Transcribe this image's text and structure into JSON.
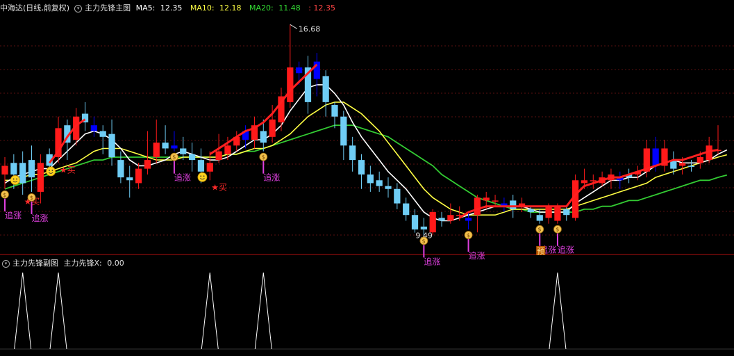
{
  "header_main": {
    "stock_label": "中海达(日线,前复权)",
    "indicator_title": "主力先锋主图",
    "ma5_label": "MA5:",
    "ma5_value": "12.35",
    "ma10_label": "MA10:",
    "ma10_value": "12.18",
    "ma20_label": "MA20:",
    "ma20_value": "11.48",
    "last_value": ": 12.35"
  },
  "header_sub": {
    "indicator_title": "主力先锋副图",
    "value_label": "主力先锋X:",
    "value": "0.00"
  },
  "colors": {
    "up": "#ff1a1a",
    "down": "#6fcdf5",
    "blue_down": "#0000ff",
    "ma5": "#ffffff",
    "ma10": "#ffff44",
    "ma20": "#33cc33",
    "signal": "#ff2020",
    "grid": "#5a1010",
    "buy_text": "#ff2a2a",
    "chase_text": "#e040e0"
  },
  "chart_data": {
    "type": "candlestick",
    "y_max_label": "16.68",
    "y_min_label": "9.49",
    "preview_label": "预",
    "buy_label": "★买",
    "chase_label": "追涨",
    "buy_signals": [
      2,
      6,
      23
    ],
    "smiley_signals": [
      1,
      5,
      22
    ],
    "chase_signals": [
      0,
      3,
      19,
      29,
      47,
      52,
      60,
      62
    ],
    "sub_peaks": [
      2,
      6,
      23,
      29,
      62
    ],
    "candles": [
      {
        "o": 11.5,
        "c": 11.8,
        "h": 12.1,
        "l": 11.0,
        "color": "up"
      },
      {
        "o": 11.9,
        "c": 11.5,
        "h": 12.2,
        "l": 11.0,
        "color": "down"
      },
      {
        "o": 11.9,
        "c": 11.2,
        "h": 12.3,
        "l": 10.8,
        "color": "down"
      },
      {
        "o": 12.0,
        "c": 11.4,
        "h": 12.5,
        "l": 10.9,
        "color": "down"
      },
      {
        "o": 10.9,
        "c": 11.9,
        "h": 12.2,
        "l": 10.5,
        "color": "up"
      },
      {
        "o": 12.2,
        "c": 11.8,
        "h": 12.4,
        "l": 11.6,
        "color": "down"
      },
      {
        "o": 12.1,
        "c": 13.1,
        "h": 13.5,
        "l": 11.9,
        "color": "up"
      },
      {
        "o": 13.2,
        "c": 12.6,
        "h": 13.4,
        "l": 12.0,
        "color": "down"
      },
      {
        "o": 12.7,
        "c": 13.5,
        "h": 13.8,
        "l": 12.5,
        "color": "up"
      },
      {
        "o": 13.6,
        "c": 13.3,
        "h": 14.0,
        "l": 13.0,
        "color": "down"
      },
      {
        "o": 13.2,
        "c": 13.0,
        "h": 13.5,
        "l": 12.8,
        "color": "blue_down"
      },
      {
        "o": 13.0,
        "c": 12.8,
        "h": 13.2,
        "l": 12.2,
        "color": "down"
      },
      {
        "o": 12.9,
        "c": 12.1,
        "h": 13.4,
        "l": 11.8,
        "color": "down"
      },
      {
        "o": 12.0,
        "c": 11.4,
        "h": 12.3,
        "l": 11.2,
        "color": "down"
      },
      {
        "o": 11.4,
        "c": 11.3,
        "h": 11.8,
        "l": 10.7,
        "color": "down"
      },
      {
        "o": 11.2,
        "c": 11.7,
        "h": 11.9,
        "l": 11.0,
        "color": "up"
      },
      {
        "o": 11.7,
        "c": 12.0,
        "h": 13.0,
        "l": 11.5,
        "color": "up"
      },
      {
        "o": 12.1,
        "c": 12.6,
        "h": 13.4,
        "l": 11.9,
        "color": "up"
      },
      {
        "o": 12.6,
        "c": 12.4,
        "h": 13.2,
        "l": 12.2,
        "color": "down"
      },
      {
        "o": 12.4,
        "c": 12.5,
        "h": 13.0,
        "l": 12.3,
        "color": "blue_down"
      },
      {
        "o": 12.4,
        "c": 12.2,
        "h": 12.8,
        "l": 12.0,
        "color": "down"
      },
      {
        "o": 12.2,
        "c": 12.0,
        "h": 12.6,
        "l": 11.6,
        "color": "down"
      },
      {
        "o": 12.0,
        "c": 11.6,
        "h": 12.4,
        "l": 11.2,
        "color": "down"
      },
      {
        "o": 11.6,
        "c": 11.9,
        "h": 12.3,
        "l": 11.3,
        "color": "up"
      },
      {
        "o": 12.0,
        "c": 12.3,
        "h": 12.9,
        "l": 11.9,
        "color": "up"
      },
      {
        "o": 12.2,
        "c": 12.5,
        "h": 12.8,
        "l": 12.0,
        "color": "up"
      },
      {
        "o": 12.5,
        "c": 12.8,
        "h": 13.0,
        "l": 12.3,
        "color": "up"
      },
      {
        "o": 12.7,
        "c": 13.0,
        "h": 13.2,
        "l": 12.4,
        "color": "blue_down"
      },
      {
        "o": 12.7,
        "c": 13.2,
        "h": 13.5,
        "l": 12.4,
        "color": "up"
      },
      {
        "o": 13.0,
        "c": 12.6,
        "h": 13.4,
        "l": 12.3,
        "color": "down"
      },
      {
        "o": 12.8,
        "c": 13.4,
        "h": 13.9,
        "l": 12.6,
        "color": "up"
      },
      {
        "o": 13.3,
        "c": 14.2,
        "h": 14.5,
        "l": 13.0,
        "color": "up"
      },
      {
        "o": 14.0,
        "c": 15.2,
        "h": 16.68,
        "l": 13.8,
        "color": "up"
      },
      {
        "o": 15.2,
        "c": 15.0,
        "h": 15.4,
        "l": 14.6,
        "color": "blue_down"
      },
      {
        "o": 15.2,
        "c": 14.0,
        "h": 15.6,
        "l": 13.6,
        "color": "down"
      },
      {
        "o": 15.4,
        "c": 14.8,
        "h": 15.7,
        "l": 14.2,
        "color": "blue_down"
      },
      {
        "o": 14.9,
        "c": 14.0,
        "h": 15.1,
        "l": 13.5,
        "color": "down"
      },
      {
        "o": 13.9,
        "c": 13.5,
        "h": 14.0,
        "l": 13.1,
        "color": "down"
      },
      {
        "o": 13.5,
        "c": 12.5,
        "h": 13.7,
        "l": 12.0,
        "color": "down"
      },
      {
        "o": 12.5,
        "c": 12.0,
        "h": 12.8,
        "l": 11.6,
        "color": "down"
      },
      {
        "o": 12.0,
        "c": 11.5,
        "h": 12.2,
        "l": 11.0,
        "color": "down"
      },
      {
        "o": 11.5,
        "c": 11.2,
        "h": 11.8,
        "l": 10.9,
        "color": "down"
      },
      {
        "o": 11.3,
        "c": 11.1,
        "h": 11.6,
        "l": 10.9,
        "color": "down"
      },
      {
        "o": 11.1,
        "c": 11.0,
        "h": 11.4,
        "l": 10.7,
        "color": "down"
      },
      {
        "o": 11.0,
        "c": 10.5,
        "h": 11.2,
        "l": 10.3,
        "color": "down"
      },
      {
        "o": 10.5,
        "c": 10.1,
        "h": 10.7,
        "l": 9.9,
        "color": "down"
      },
      {
        "o": 10.1,
        "c": 9.6,
        "h": 10.3,
        "l": 9.49,
        "color": "down"
      },
      {
        "o": 9.6,
        "c": 9.7,
        "h": 10.0,
        "l": 9.4,
        "color": "down"
      },
      {
        "o": 9.5,
        "c": 10.2,
        "h": 10.3,
        "l": 9.4,
        "color": "up"
      },
      {
        "o": 9.9,
        "c": 10.0,
        "h": 10.2,
        "l": 9.7,
        "color": "down"
      },
      {
        "o": 9.9,
        "c": 10.1,
        "h": 10.5,
        "l": 9.8,
        "color": "up"
      },
      {
        "o": 10.1,
        "c": 10.1,
        "h": 10.4,
        "l": 9.9,
        "color": "up"
      },
      {
        "o": 10.0,
        "c": 9.9,
        "h": 10.2,
        "l": 9.6,
        "color": "blue_down"
      },
      {
        "o": 10.1,
        "c": 10.7,
        "h": 10.8,
        "l": 9.5,
        "color": "up"
      },
      {
        "o": 10.6,
        "c": 10.7,
        "h": 10.9,
        "l": 10.3,
        "color": "up"
      },
      {
        "o": 10.6,
        "c": 10.6,
        "h": 10.8,
        "l": 10.4,
        "color": "up"
      },
      {
        "o": 10.5,
        "c": 10.4,
        "h": 10.7,
        "l": 10.2,
        "color": "blue_down"
      },
      {
        "o": 10.6,
        "c": 10.3,
        "h": 10.8,
        "l": 10.0,
        "color": "down"
      },
      {
        "o": 10.4,
        "c": 10.5,
        "h": 10.7,
        "l": 10.2,
        "color": "up"
      },
      {
        "o": 10.3,
        "c": 10.2,
        "h": 10.4,
        "l": 10.0,
        "color": "down"
      },
      {
        "o": 10.1,
        "c": 9.9,
        "h": 10.3,
        "l": 9.8,
        "color": "down"
      },
      {
        "o": 10.0,
        "c": 10.4,
        "h": 10.5,
        "l": 9.8,
        "color": "up"
      },
      {
        "o": 9.9,
        "c": 10.4,
        "h": 10.5,
        "l": 9.8,
        "color": "up"
      },
      {
        "o": 10.3,
        "c": 10.1,
        "h": 10.4,
        "l": 9.9,
        "color": "down"
      },
      {
        "o": 10.0,
        "c": 11.3,
        "h": 11.5,
        "l": 9.9,
        "color": "up"
      },
      {
        "o": 11.2,
        "c": 11.3,
        "h": 11.7,
        "l": 11.0,
        "color": "up"
      },
      {
        "o": 11.3,
        "c": 11.3,
        "h": 11.5,
        "l": 11.0,
        "color": "up"
      },
      {
        "o": 11.2,
        "c": 11.4,
        "h": 11.6,
        "l": 11.1,
        "color": "up"
      },
      {
        "o": 11.3,
        "c": 11.5,
        "h": 11.7,
        "l": 11.0,
        "color": "up"
      },
      {
        "o": 11.4,
        "c": 11.3,
        "h": 11.6,
        "l": 11.0,
        "color": "blue_down"
      },
      {
        "o": 11.5,
        "c": 11.4,
        "h": 11.7,
        "l": 11.2,
        "color": "down"
      },
      {
        "o": 11.5,
        "c": 11.6,
        "h": 11.8,
        "l": 11.3,
        "color": "up"
      },
      {
        "o": 11.6,
        "c": 12.4,
        "h": 12.7,
        "l": 11.4,
        "color": "up"
      },
      {
        "o": 12.4,
        "c": 11.8,
        "h": 12.8,
        "l": 11.6,
        "color": "blue_down"
      },
      {
        "o": 11.8,
        "c": 12.4,
        "h": 12.7,
        "l": 11.6,
        "color": "up"
      },
      {
        "o": 12.0,
        "c": 11.7,
        "h": 12.3,
        "l": 11.5,
        "color": "down"
      },
      {
        "o": 11.8,
        "c": 11.9,
        "h": 12.1,
        "l": 11.5,
        "color": "up"
      },
      {
        "o": 11.8,
        "c": 11.8,
        "h": 12.0,
        "l": 11.6,
        "color": "down"
      },
      {
        "o": 11.9,
        "c": 12.1,
        "h": 12.3,
        "l": 11.7,
        "color": "up"
      },
      {
        "o": 12.0,
        "c": 12.5,
        "h": 12.8,
        "l": 11.9,
        "color": "up"
      },
      {
        "o": 12.35,
        "c": 12.35,
        "h": 13.2,
        "l": 12.2,
        "color": "up"
      }
    ],
    "ma5": [
      11.2,
      11.4,
      11.5,
      11.6,
      11.7,
      11.7,
      12.0,
      12.3,
      12.6,
      12.9,
      13.0,
      12.9,
      12.7,
      12.4,
      12.0,
      11.8,
      11.8,
      11.9,
      12.0,
      12.2,
      12.3,
      12.2,
      12.1,
      12.0,
      12.0,
      12.1,
      12.3,
      12.5,
      12.7,
      12.7,
      12.9,
      13.2,
      13.7,
      14.1,
      14.5,
      14.6,
      14.6,
      14.3,
      13.9,
      13.3,
      12.8,
      12.4,
      12.0,
      11.6,
      11.3,
      11.0,
      10.6,
      10.2,
      10.0,
      9.9,
      9.9,
      10.0,
      10.1,
      10.2,
      10.3,
      10.4,
      10.4,
      10.4,
      10.4,
      10.3,
      10.2,
      10.2,
      10.2,
      10.2,
      10.5,
      10.7,
      10.9,
      11.1,
      11.3,
      11.3,
      11.4,
      11.4,
      11.6,
      11.8,
      11.9,
      12.0,
      11.9,
      11.9,
      11.9,
      12.0,
      12.2,
      12.35
    ],
    "ma10": [
      11.3,
      11.3,
      11.4,
      11.5,
      11.5,
      11.6,
      11.7,
      11.8,
      11.9,
      12.1,
      12.3,
      12.4,
      12.4,
      12.4,
      12.3,
      12.2,
      12.1,
      12.0,
      12.0,
      12.0,
      12.1,
      12.1,
      12.1,
      12.1,
      12.1,
      12.2,
      12.2,
      12.3,
      12.4,
      12.4,
      12.5,
      12.7,
      12.9,
      13.2,
      13.5,
      13.7,
      13.9,
      14.0,
      14.0,
      13.8,
      13.6,
      13.3,
      13.0,
      12.6,
      12.2,
      11.8,
      11.4,
      11.0,
      10.7,
      10.5,
      10.3,
      10.2,
      10.1,
      10.1,
      10.1,
      10.1,
      10.2,
      10.3,
      10.3,
      10.3,
      10.3,
      10.3,
      10.3,
      10.3,
      10.4,
      10.5,
      10.6,
      10.7,
      10.8,
      10.9,
      11.0,
      11.1,
      11.2,
      11.4,
      11.5,
      11.6,
      11.7,
      11.8,
      11.9,
      12.0,
      12.1,
      12.18
    ],
    "ma20": [
      11.0,
      11.1,
      11.2,
      11.3,
      11.4,
      11.5,
      11.6,
      11.7,
      11.8,
      11.9,
      12.0,
      12.0,
      12.1,
      12.1,
      12.1,
      12.1,
      12.1,
      12.1,
      12.1,
      12.1,
      12.1,
      12.1,
      12.1,
      12.1,
      12.1,
      12.2,
      12.2,
      12.3,
      12.3,
      12.4,
      12.5,
      12.6,
      12.7,
      12.8,
      12.9,
      13.0,
      13.1,
      13.2,
      13.2,
      13.2,
      13.1,
      13.0,
      12.9,
      12.8,
      12.6,
      12.4,
      12.2,
      12.0,
      11.8,
      11.5,
      11.3,
      11.1,
      10.9,
      10.7,
      10.6,
      10.5,
      10.4,
      10.3,
      10.3,
      10.2,
      10.2,
      10.2,
      10.2,
      10.2,
      10.2,
      10.3,
      10.3,
      10.4,
      10.4,
      10.5,
      10.6,
      10.6,
      10.7,
      10.8,
      10.9,
      11.0,
      11.1,
      11.2,
      11.3,
      11.3,
      11.4,
      11.48
    ],
    "signal": [
      null,
      null,
      null,
      null,
      null,
      11.9,
      12.3,
      12.8,
      13.2,
      13.4,
      null,
      null,
      null,
      null,
      null,
      null,
      null,
      null,
      null,
      null,
      null,
      null,
      null,
      12.2,
      12.4,
      12.6,
      12.8,
      13.0,
      13.1,
      13.3,
      13.6,
      14.0,
      14.4,
      14.7,
      15.0,
      15.3,
      null,
      null,
      null,
      null,
      null,
      null,
      null,
      null,
      null,
      null,
      null,
      null,
      null,
      null,
      null,
      10.0,
      10.2,
      10.3,
      10.4,
      10.4,
      10.4,
      10.4,
      10.4,
      10.4,
      10.4,
      10.4,
      10.4,
      10.4,
      10.8,
      11.1,
      11.2,
      11.3,
      11.4,
      11.4,
      11.5,
      11.6,
      11.7,
      11.8,
      11.9,
      12.0,
      12.0,
      12.1,
      12.2,
      12.3,
      12.35,
      null
    ]
  }
}
